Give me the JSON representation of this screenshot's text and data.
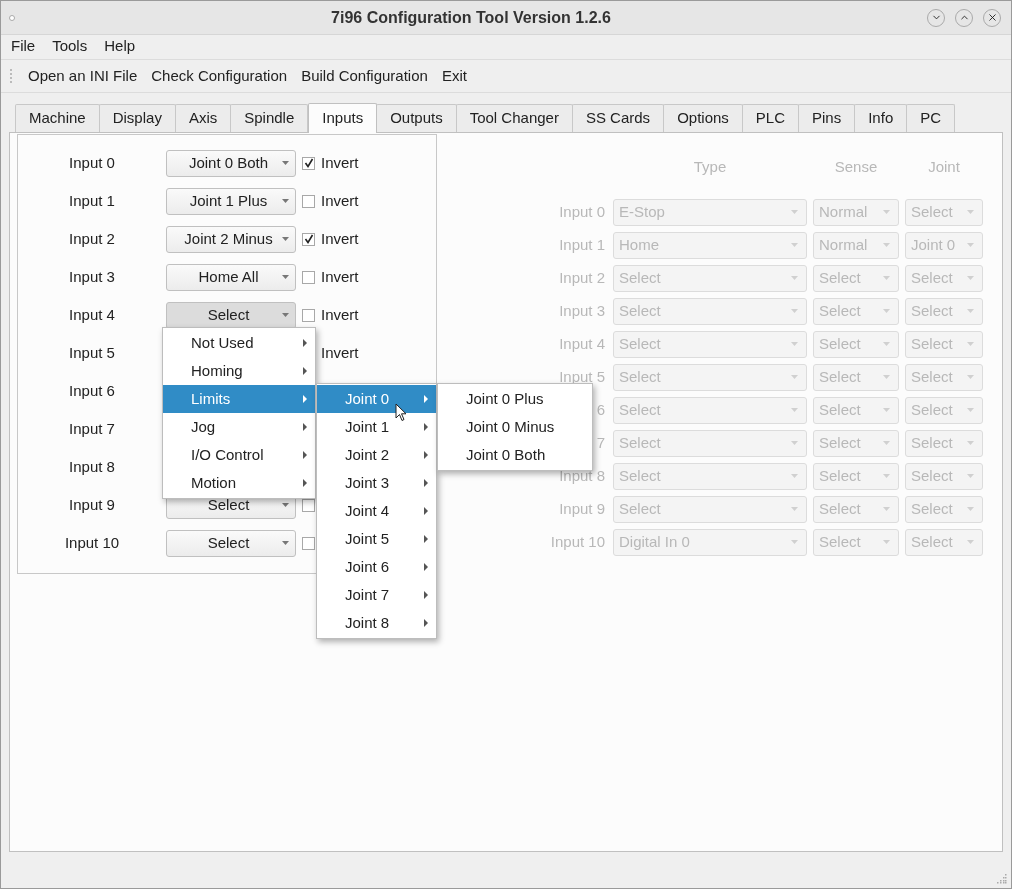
{
  "window": {
    "title": "7i96 Configuration Tool Version 1.2.6"
  },
  "menu_bar": [
    "File",
    "Tools",
    "Help"
  ],
  "toolbar": [
    "Open an INI File",
    "Check Configuration",
    "Build Configuration",
    "Exit"
  ],
  "tabs": [
    {
      "label": "Machine",
      "selected": false
    },
    {
      "label": "Display",
      "selected": false
    },
    {
      "label": "Axis",
      "selected": false
    },
    {
      "label": "Spindle",
      "selected": false
    },
    {
      "label": "Inputs",
      "selected": true
    },
    {
      "label": "Outputs",
      "selected": false
    },
    {
      "label": "Tool Changer",
      "selected": false
    },
    {
      "label": "SS Cards",
      "selected": false
    },
    {
      "label": "Options",
      "selected": false
    },
    {
      "label": "PLC",
      "selected": false
    },
    {
      "label": "Pins",
      "selected": false
    },
    {
      "label": "Info",
      "selected": false
    },
    {
      "label": "PC",
      "selected": false
    }
  ],
  "inputs": [
    {
      "label": "Input 0",
      "value": "Joint 0 Both",
      "open": false,
      "checked": true,
      "invert_label": "Invert"
    },
    {
      "label": "Input 1",
      "value": "Joint 1 Plus",
      "open": false,
      "checked": false,
      "invert_label": "Invert"
    },
    {
      "label": "Input 2",
      "value": "Joint 2 Minus",
      "open": false,
      "checked": true,
      "invert_label": "Invert"
    },
    {
      "label": "Input 3",
      "value": "Home All",
      "open": false,
      "checked": false,
      "invert_label": "Invert"
    },
    {
      "label": "Input 4",
      "value": "Select",
      "open": true,
      "checked": false,
      "invert_label": "Invert"
    },
    {
      "label": "Input 5",
      "invert_label": "Invert"
    },
    {
      "label": "Input 6"
    },
    {
      "label": "Input 7"
    },
    {
      "label": "Input 8"
    },
    {
      "label": "Input 9",
      "value": "Select",
      "open": false,
      "checked": false
    },
    {
      "label": "Input 10",
      "value": "Select",
      "open": false,
      "checked": false
    }
  ],
  "hardware_inputs": {
    "disabled": true,
    "columns": [
      "Type",
      "Sense",
      "Joint"
    ],
    "rows": [
      {
        "label": "Input 0",
        "type": "E-Stop",
        "sense": "Normal",
        "joint": "Select"
      },
      {
        "label": "Input 1",
        "type": "Home",
        "sense": "Normal",
        "joint": "Joint 0"
      },
      {
        "label": "Input 2",
        "type": "Select",
        "sense": "Select",
        "joint": "Select"
      },
      {
        "label": "Input 3",
        "type": "Select",
        "sense": "Select",
        "joint": "Select"
      },
      {
        "label": "Input 4",
        "type": "Select",
        "sense": "Select",
        "joint": "Select"
      },
      {
        "label": "Input 5",
        "type": "Select",
        "sense": "Select",
        "joint": "Select"
      },
      {
        "label": "6",
        "type": "Select",
        "sense": "Select",
        "joint": "Select"
      },
      {
        "label": "7",
        "type": "Select",
        "sense": "Select",
        "joint": "Select"
      },
      {
        "label": "Input 8",
        "type": "Select",
        "sense": "Select",
        "joint": "Select"
      },
      {
        "label": "Input 9",
        "type": "Select",
        "sense": "Select",
        "joint": "Select"
      },
      {
        "label": "Input 10",
        "type": "Digital In 0",
        "sense": "Select",
        "joint": "Select"
      }
    ]
  },
  "menus": [
    {
      "items": [
        {
          "label": "Not Used",
          "selected": false,
          "has_submenu": true
        },
        {
          "label": "Homing",
          "selected": false,
          "has_submenu": true
        },
        {
          "label": "Limits",
          "selected": true,
          "has_submenu": true
        },
        {
          "label": "Jog",
          "selected": false,
          "has_submenu": true
        },
        {
          "label": "I/O Control",
          "selected": false,
          "has_submenu": true
        },
        {
          "label": "Motion",
          "selected": false,
          "has_submenu": true
        }
      ]
    },
    {
      "items": [
        {
          "label": "Joint 0",
          "selected": true,
          "has_submenu": true
        },
        {
          "label": "Joint 1",
          "selected": false,
          "has_submenu": true
        },
        {
          "label": "Joint 2",
          "selected": false,
          "has_submenu": true
        },
        {
          "label": "Joint 3",
          "selected": false,
          "has_submenu": true
        },
        {
          "label": "Joint 4",
          "selected": false,
          "has_submenu": true
        },
        {
          "label": "Joint 5",
          "selected": false,
          "has_submenu": true
        },
        {
          "label": "Joint 6",
          "selected": false,
          "has_submenu": true
        },
        {
          "label": "Joint 7",
          "selected": false,
          "has_submenu": true
        },
        {
          "label": "Joint 8",
          "selected": false,
          "has_submenu": true
        }
      ]
    },
    {
      "items": [
        {
          "label": "Joint 0 Plus",
          "selected": false,
          "has_submenu": false
        },
        {
          "label": "Joint 0 Minus",
          "selected": false,
          "has_submenu": false
        },
        {
          "label": "Joint 0 Both",
          "selected": false,
          "has_submenu": false
        }
      ]
    }
  ]
}
